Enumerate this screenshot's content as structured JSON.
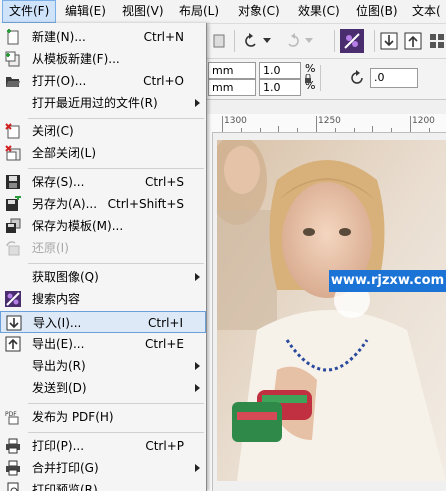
{
  "menubar": {
    "items": [
      {
        "label": "文件(F)"
      },
      {
        "label": "编辑(E)"
      },
      {
        "label": "视图(V)"
      },
      {
        "label": "布局(L)"
      },
      {
        "label": "对象(C)"
      },
      {
        "label": "效果(C)"
      },
      {
        "label": "位图(B)"
      },
      {
        "label": "文本("
      }
    ]
  },
  "toolbar": {
    "width_unit": "mm",
    "height_unit": "mm",
    "scale_x": "1.0",
    "scale_y": "1.0",
    "percent": "%",
    "rotation": ".0"
  },
  "ruler": {
    "labels": [
      "1300",
      "1250",
      "1200"
    ]
  },
  "watermark": {
    "text": "www.rjzxw.com"
  },
  "file_menu": {
    "items": [
      {
        "label": "新建(N)...",
        "shortcut": "Ctrl+N",
        "icon": "new-document-icon"
      },
      {
        "label": "从模板新建(F)...",
        "shortcut": "",
        "icon": "new-from-template-icon"
      },
      {
        "label": "打开(O)...",
        "shortcut": "Ctrl+O",
        "icon": "open-folder-icon"
      },
      {
        "label": "打开最近用过的文件(R)",
        "shortcut": "",
        "icon": ""
      },
      {
        "label": "关闭(C)",
        "shortcut": "",
        "icon": "close-document-icon"
      },
      {
        "label": "全部关闭(L)",
        "shortcut": "",
        "icon": "close-all-icon"
      },
      {
        "label": "保存(S)...",
        "shortcut": "Ctrl+S",
        "icon": "save-icon"
      },
      {
        "label": "另存为(A)...",
        "shortcut": "Ctrl+Shift+S",
        "icon": "save-as-icon"
      },
      {
        "label": "保存为模板(M)...",
        "shortcut": "",
        "icon": "save-template-icon"
      },
      {
        "label": "还原(I)",
        "shortcut": "",
        "icon": "revert-icon"
      },
      {
        "label": "获取图像(Q)",
        "shortcut": "",
        "icon": ""
      },
      {
        "label": "搜索内容",
        "shortcut": "",
        "icon": "search-content-icon"
      },
      {
        "label": "导入(I)...",
        "shortcut": "Ctrl+I",
        "icon": "import-icon"
      },
      {
        "label": "导出(E)...",
        "shortcut": "Ctrl+E",
        "icon": "export-icon"
      },
      {
        "label": "导出为(R)",
        "shortcut": "",
        "icon": ""
      },
      {
        "label": "发送到(D)",
        "shortcut": "",
        "icon": ""
      },
      {
        "label": "发布为 PDF(H)",
        "shortcut": "",
        "icon": "pdf-icon"
      },
      {
        "label": "打印(P)...",
        "shortcut": "Ctrl+P",
        "icon": "print-icon"
      },
      {
        "label": "合并打印(G)",
        "shortcut": "",
        "icon": "merge-print-icon"
      },
      {
        "label": "打印预览(R)",
        "shortcut": "",
        "icon": "print-preview-icon"
      }
    ]
  }
}
